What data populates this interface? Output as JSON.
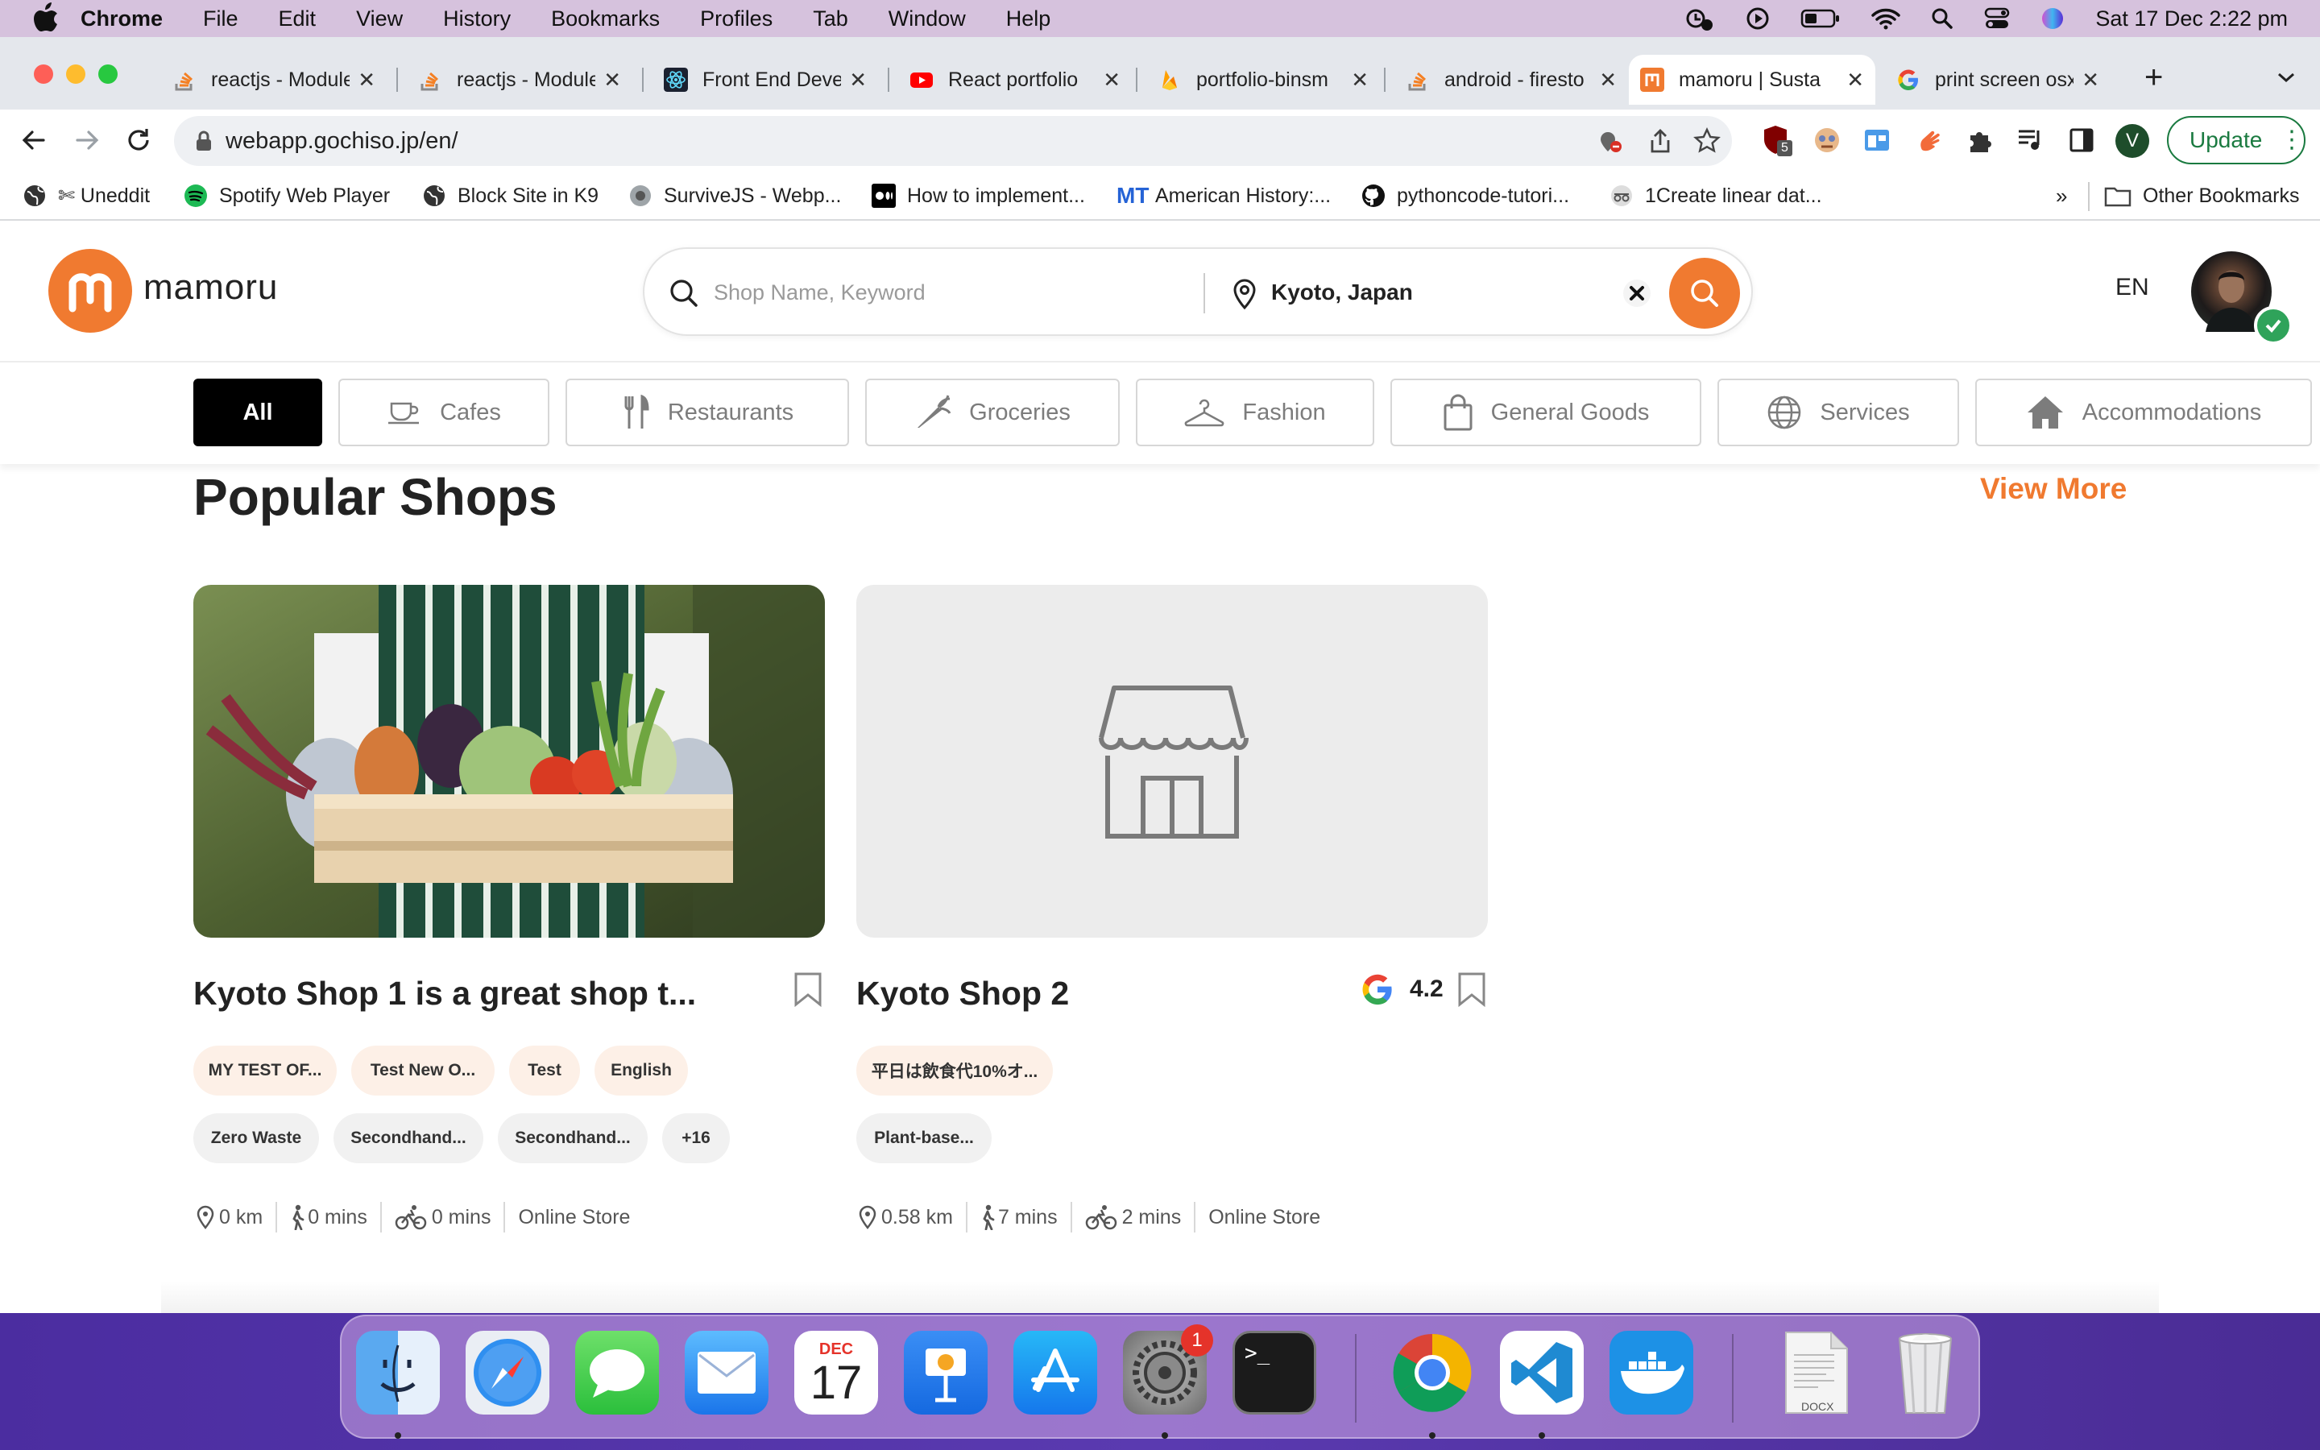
{
  "menubar": {
    "app": "Chrome",
    "items": [
      "File",
      "Edit",
      "View",
      "History",
      "Bookmarks",
      "Profiles",
      "Tab",
      "Window",
      "Help"
    ],
    "clock": "Sat 17 Dec  2:22 pm"
  },
  "tabs": [
    {
      "title": "reactjs - Module"
    },
    {
      "title": "reactjs - Module"
    },
    {
      "title": "Front End Devel"
    },
    {
      "title": "React portfolio"
    },
    {
      "title": "portfolio-binsm"
    },
    {
      "title": "android - firesto"
    },
    {
      "title": "mamoru | Susta"
    },
    {
      "title": "print screen osx"
    }
  ],
  "address": {
    "url": "webapp.gochiso.jp/en/"
  },
  "profile_letter": "V",
  "extension_badge": "5",
  "update_label": "Update",
  "bookmarks": [
    {
      "label": "✄ Uneddit"
    },
    {
      "label": "Spotify Web Player"
    },
    {
      "label": "Block Site in K9"
    },
    {
      "label": "SurviveJS - Webp..."
    },
    {
      "label": "How to implement..."
    },
    {
      "label": "American History:..."
    },
    {
      "label": "pythoncode-tutori..."
    },
    {
      "label": "1Create linear dat..."
    }
  ],
  "bookmarks_more": "»",
  "other_bookmarks": "Other Bookmarks",
  "site": {
    "brand": "mamoru",
    "search_placeholder": "Shop Name, Keyword",
    "location_value": "Kyoto, Japan",
    "lang": "EN"
  },
  "categories": [
    {
      "label": "All",
      "icon": "none"
    },
    {
      "label": "Cafes",
      "icon": "coffee-cup-icon"
    },
    {
      "label": "Restaurants",
      "icon": "fork-knife-icon"
    },
    {
      "label": "Groceries",
      "icon": "carrot-icon"
    },
    {
      "label": "Fashion",
      "icon": "hanger-icon"
    },
    {
      "label": "General Goods",
      "icon": "shopping-bag-icon"
    },
    {
      "label": "Services",
      "icon": "globe-icon"
    },
    {
      "label": "Accommodations",
      "icon": "house-icon"
    }
  ],
  "section": {
    "title": "Popular Shops",
    "view_more": "View More"
  },
  "shops": [
    {
      "title": "Kyoto Shop 1 is a great shop t...",
      "tags_row1": [
        "MY TEST OF...",
        "Test New O...",
        "Test",
        "English"
      ],
      "tags_row2": [
        "Zero Waste",
        "Secondhand...",
        "Secondhand...",
        "+16"
      ],
      "distance": "0 km",
      "walk": "0 mins",
      "bike": "0 mins",
      "type": "Online Store"
    },
    {
      "title": "Kyoto Shop 2",
      "rating": "4.2",
      "tags_row1": [
        "平日は飲食代10%オ..."
      ],
      "tags_row2": [
        "Plant-base..."
      ],
      "distance": "0.58 km",
      "walk": "7 mins",
      "bike": "2 mins",
      "type": "Online Store"
    }
  ],
  "dock": {
    "calendar_month": "DEC",
    "calendar_day": "17",
    "settings_badge": "1",
    "docx_label": "DOCX",
    "apps": [
      "finder-icon",
      "safari-icon",
      "messages-icon",
      "mail-icon",
      "calendar-icon",
      "keynote-icon",
      "app-store-icon",
      "system-preferences-icon",
      "terminal-icon",
      "chrome-icon",
      "vscode-icon",
      "docker-icon",
      "docx-file-icon",
      "trash-icon"
    ]
  },
  "colors": {
    "accent": "#f07a30",
    "active_category": "#000000",
    "tag_pink": "#fdf0e7",
    "tag_grey": "#f1f1f1"
  }
}
